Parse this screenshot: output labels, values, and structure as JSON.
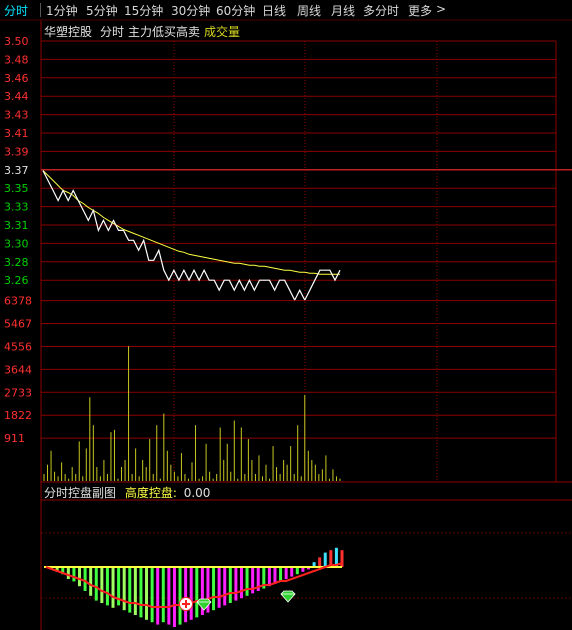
{
  "tabs": [
    {
      "label": "分时",
      "active": true
    },
    {
      "label": "1分钟"
    },
    {
      "label": "5分钟"
    },
    {
      "label": "15分钟"
    },
    {
      "label": "30分钟"
    },
    {
      "label": "60分钟"
    },
    {
      "label": "日线"
    },
    {
      "label": "周线"
    },
    {
      "label": "月线"
    },
    {
      "label": "多分时"
    },
    {
      "label": "更多"
    }
  ],
  "more_arrow": ">",
  "stock_name": "华塑控股",
  "mode_label": "分时",
  "indicator_label": "主力低买高卖",
  "volume_label": "成交量",
  "sub_panel": {
    "title": "分时控盘副图",
    "indicator": "高度控盘:",
    "value": "0.00"
  },
  "colors": {
    "up": "#ff3030",
    "down": "#00ff00",
    "price": "#ffffff",
    "avg": "#ffff40",
    "grid": "#8b0000",
    "volume": "#c8c820",
    "magenta": "#ff20ff",
    "green_bar": "#40ff40"
  },
  "icons": [
    "plus-circle-icon",
    "green-gem-icon"
  ],
  "chart_data": [
    {
      "type": "line",
      "title": "分时",
      "y_ticks": [
        "3.50",
        "3.48",
        "3.46",
        "3.44",
        "3.43",
        "3.41",
        "3.39",
        "3.37",
        "3.35",
        "3.33",
        "3.31",
        "3.30",
        "3.28",
        "3.26"
      ],
      "ylim": [
        3.26,
        3.5
      ],
      "prev_close": 3.37,
      "series": [
        {
          "name": "price",
          "values": [
            3.37,
            3.36,
            3.35,
            3.34,
            3.35,
            3.34,
            3.35,
            3.34,
            3.33,
            3.32,
            3.33,
            3.31,
            3.32,
            3.31,
            3.32,
            3.31,
            3.31,
            3.3,
            3.3,
            3.29,
            3.3,
            3.28,
            3.28,
            3.29,
            3.27,
            3.26,
            3.27,
            3.26,
            3.27,
            3.26,
            3.27,
            3.26,
            3.27,
            3.26,
            3.26,
            3.25,
            3.26,
            3.26,
            3.25,
            3.26,
            3.25,
            3.26,
            3.25,
            3.26,
            3.26,
            3.26,
            3.25,
            3.26,
            3.26,
            3.25,
            3.24,
            3.25,
            3.24,
            3.25,
            3.26,
            3.27,
            3.27,
            3.27,
            3.26,
            3.27
          ]
        },
        {
          "name": "avg",
          "values": [
            3.37,
            3.365,
            3.36,
            3.355,
            3.35,
            3.348,
            3.345,
            3.34,
            3.337,
            3.333,
            3.33,
            3.327,
            3.323,
            3.32,
            3.317,
            3.314,
            3.311,
            3.309,
            3.307,
            3.305,
            3.303,
            3.301,
            3.299,
            3.297,
            3.295,
            3.293,
            3.291,
            3.289,
            3.288,
            3.286,
            3.285,
            3.284,
            3.283,
            3.282,
            3.281,
            3.28,
            3.279,
            3.278,
            3.277,
            3.277,
            3.276,
            3.275,
            3.275,
            3.274,
            3.274,
            3.273,
            3.272,
            3.271,
            3.27,
            3.27,
            3.269,
            3.268,
            3.268,
            3.267,
            3.267,
            3.266,
            3.266,
            3.266,
            3.266,
            3.266
          ]
        }
      ]
    },
    {
      "type": "bar",
      "title": "成交量",
      "y_ticks": [
        "6378",
        "5467",
        "4556",
        "3644",
        "2733",
        "1822",
        "911"
      ],
      "ylim": [
        0,
        7289
      ],
      "values": [
        300,
        700,
        1300,
        400,
        200,
        800,
        300,
        100,
        600,
        300,
        1700,
        200,
        1400,
        3600,
        2400,
        600,
        200,
        900,
        300,
        2100,
        2200,
        100,
        600,
        900,
        5800,
        300,
        1400,
        200,
        900,
        600,
        1800,
        300,
        2400,
        100,
        2900,
        1300,
        700,
        400,
        200,
        1200,
        300,
        100,
        800,
        2400,
        100,
        200,
        1600,
        400,
        100,
        300,
        2300,
        900,
        1600,
        400,
        2600,
        100,
        2300,
        300,
        1800,
        900,
        300,
        1100,
        200,
        700,
        100,
        1500,
        600,
        300,
        900,
        700,
        1500,
        300,
        2400,
        200,
        3700,
        1300,
        900,
        700,
        300,
        500,
        1100,
        100,
        500,
        200,
        100
      ]
    },
    {
      "type": "bar",
      "title": "分时控盘副图",
      "series": [
        {
          "name": "高度控盘",
          "values": [
            0,
            -1,
            -2,
            -3,
            -5,
            -6,
            -8,
            -10,
            -12,
            -14,
            -15,
            -16,
            -17,
            -16,
            -18,
            -19,
            -20,
            -21,
            -22,
            -23,
            -24,
            -23,
            -24,
            -25,
            -24,
            -23,
            -22,
            -21,
            -20,
            -19,
            -18,
            -17,
            -16,
            -15,
            -14,
            -13,
            -12,
            -11,
            -10,
            -9,
            -8,
            -7,
            -6,
            -5,
            -4,
            -3,
            -2,
            -1,
            2,
            4,
            6,
            7,
            8,
            7
          ]
        },
        {
          "name": "line",
          "values": [
            0,
            -1,
            -2,
            -3,
            -4,
            -5,
            -6,
            -7,
            -9,
            -10,
            -12,
            -13,
            -15,
            -16,
            -17,
            -18,
            -18,
            -19,
            -19,
            -20,
            -20,
            -20,
            -20,
            -19,
            -19,
            -18,
            -18,
            -17,
            -17,
            -16,
            -15,
            -15,
            -14,
            -13,
            -13,
            -12,
            -11,
            -11,
            -10,
            -9,
            -9,
            -8,
            -7,
            -7,
            -6,
            -5,
            -4,
            -3,
            -2,
            -1,
            0,
            1,
            1,
            2
          ]
        }
      ]
    }
  ]
}
